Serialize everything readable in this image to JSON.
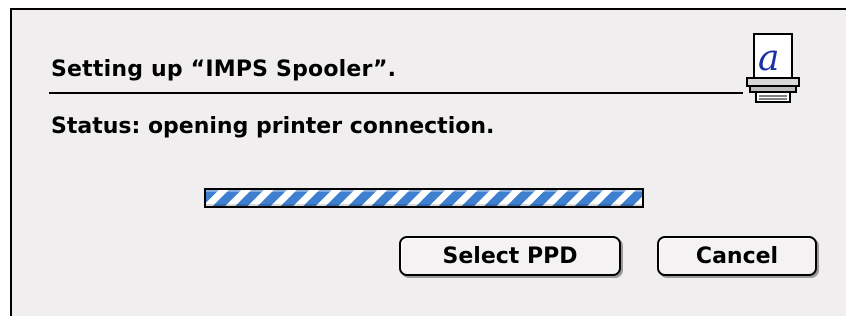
{
  "dialog": {
    "title": "Setting up “IMPS Spooler”.",
    "status": "Status: opening printer connection.",
    "icon": "printer-document-icon",
    "progress": {
      "indeterminate": true,
      "stripe_color": "#3f7fcf"
    },
    "buttons": {
      "select_ppd": "Select PPD",
      "cancel": "Cancel"
    }
  }
}
